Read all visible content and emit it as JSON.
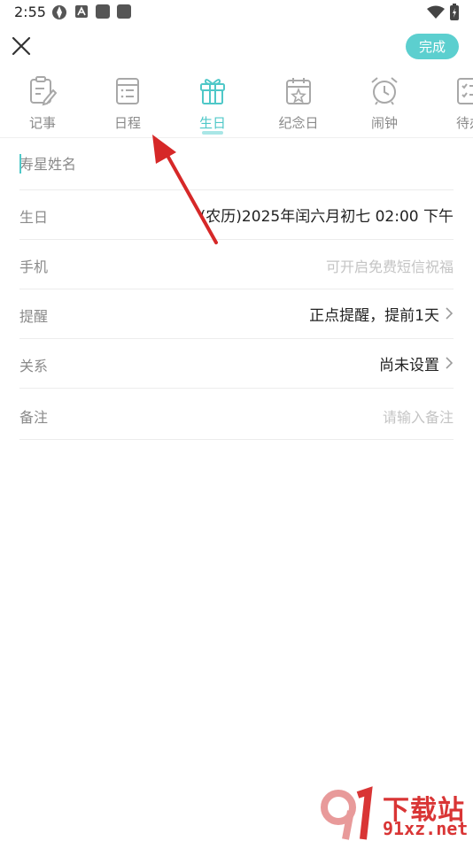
{
  "status_bar": {
    "time": "2:55"
  },
  "header": {
    "close_icon": "close-icon",
    "done_label": "完成"
  },
  "tabs": [
    {
      "label": "记事",
      "icon": "note-icon",
      "active": false
    },
    {
      "label": "日程",
      "icon": "schedule-icon",
      "active": false
    },
    {
      "label": "生日",
      "icon": "gift-icon",
      "active": true
    },
    {
      "label": "纪念日",
      "icon": "calendar-star-icon",
      "active": false
    },
    {
      "label": "闹钟",
      "icon": "alarm-icon",
      "active": false
    },
    {
      "label": "待办",
      "icon": "checklist-icon",
      "active": false
    }
  ],
  "form": {
    "name_placeholder": "寿星姓名",
    "birthday_label": "生日",
    "birthday_value": "(农历)2025年闰六月初七 02:00 下午",
    "phone_label": "手机",
    "phone_placeholder": "可开启免费短信祝福",
    "reminder_label": "提醒",
    "reminder_value": "正点提醒，提前1天",
    "relation_label": "关系",
    "relation_value": "尚未设置",
    "note_label": "备注",
    "note_placeholder": "请输入备注"
  },
  "watermark": {
    "title": "下载站",
    "url": "91xz.net"
  },
  "colors": {
    "accent": "#4fc8c8",
    "done_button": "#5ccfcf",
    "annotation_arrow": "#d62828"
  }
}
